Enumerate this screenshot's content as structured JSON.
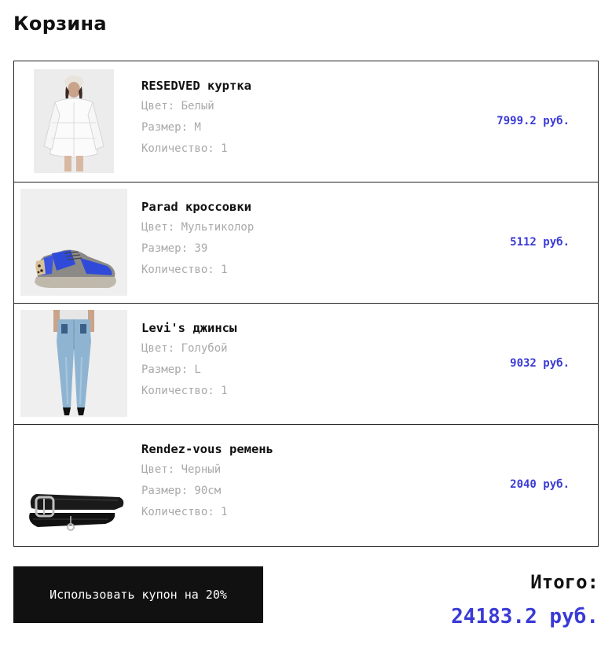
{
  "page": {
    "title": "Корзина"
  },
  "cart": {
    "items": [
      {
        "name": "RESEDVED куртка",
        "color": "Цвет: Белый",
        "size": "Размер: M",
        "quantity": "Количество: 1",
        "price": "7999.2 руб.",
        "image_icon": "white-puffer-jacket-photo"
      },
      {
        "name": "Parad кроссовки",
        "color": "Цвет: Мультиколор",
        "size": "Размер: 39",
        "quantity": "Количество: 1",
        "price": "5112 руб.",
        "image_icon": "blue-sneaker-photo"
      },
      {
        "name": "Levi's джинсы",
        "color": "Цвет: Голубой",
        "size": "Размер: L",
        "quantity": "Количество: 1",
        "price": "9032 руб.",
        "image_icon": "blue-jeans-photo"
      },
      {
        "name": "Rendez-vous ремень",
        "color": "Цвет: Черный",
        "size": "Размер: 90см",
        "quantity": "Количество: 1",
        "price": "2040 руб.",
        "image_icon": "black-belt-photo"
      }
    ]
  },
  "coupon": {
    "label": "Использовать купон на 20%"
  },
  "summary": {
    "total_label": "Итого:",
    "total_value": "24183.2 руб."
  },
  "colors": {
    "accent": "#3a3ad6",
    "button_bg": "#111111",
    "muted_text": "#a9a9a9"
  }
}
